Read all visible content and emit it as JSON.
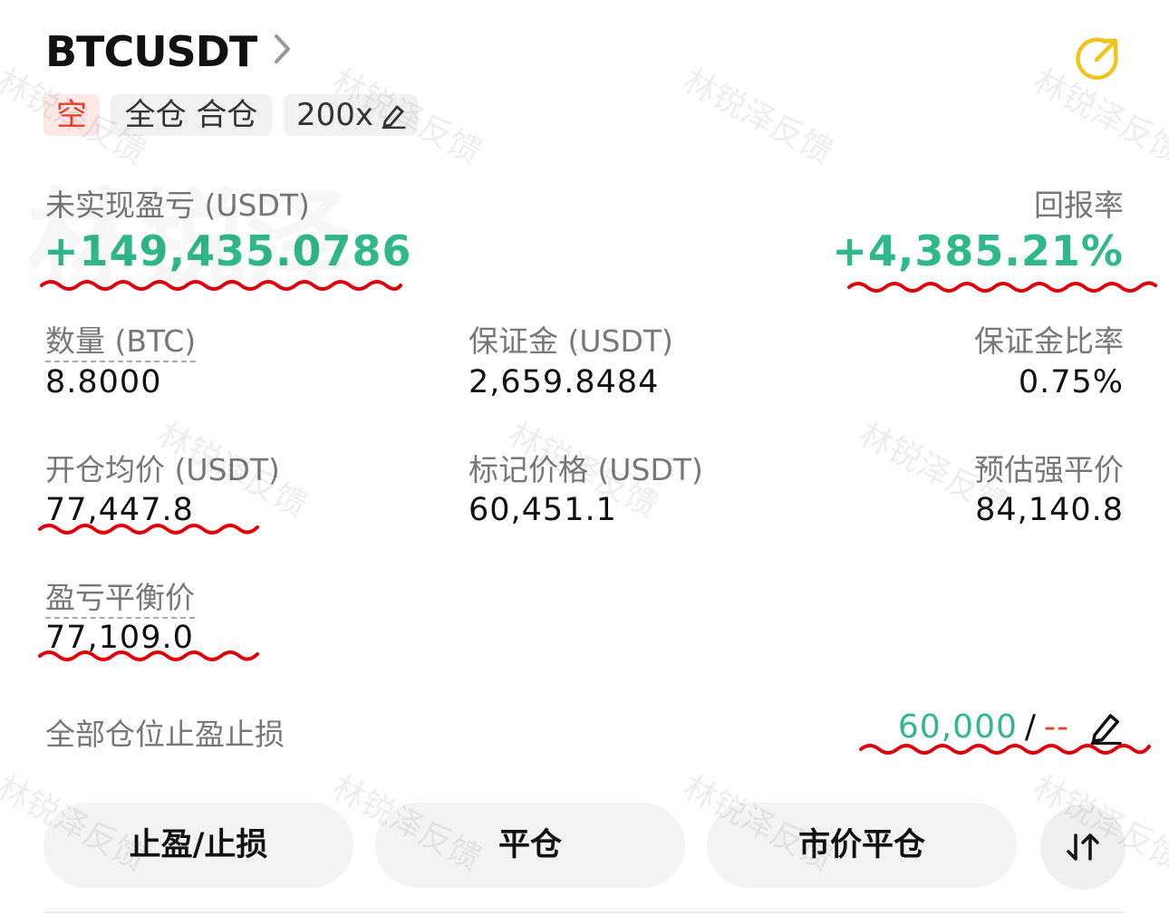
{
  "header": {
    "symbol": "BTCUSDT",
    "tags": {
      "side": "空",
      "margin_mode": "全仓 合仓",
      "leverage": "200x"
    }
  },
  "pnl": {
    "unrealized_label": "未实现盈亏 (USDT)",
    "unrealized_value": "+149,435.0786",
    "roi_label": "回报率",
    "roi_value": "+4,385.21%"
  },
  "stats": {
    "quantity_label": "数量 (BTC)",
    "quantity_value": "8.8000",
    "margin_label": "保证金 (USDT)",
    "margin_value": "2,659.8484",
    "margin_ratio_label": "保证金比率",
    "margin_ratio_value": "0.75%",
    "entry_label": "开仓均价 (USDT)",
    "entry_value": "77,447.8",
    "mark_label": "标记价格 (USDT)",
    "mark_value": "60,451.1",
    "liq_label": "预估强平价",
    "liq_value": "84,140.8",
    "breakeven_label": "盈亏平衡价",
    "breakeven_value": "77,109.0"
  },
  "tpsl": {
    "label": "全部仓位止盈止损",
    "tp_value": "60,000",
    "separator": "/",
    "sl_value": "--"
  },
  "actions": {
    "tpsl_button": "止盈/止损",
    "close_button": "平仓",
    "market_close_button": "市价平仓"
  },
  "watermark": {
    "text": "林锐泽反馈",
    "big_text": "林锐泽"
  },
  "colors": {
    "profit": "#2fb88a",
    "loss": "#e8412d",
    "accent": "#f0c419",
    "annotation": "#e0000a"
  },
  "icons": [
    "chevron-right-icon",
    "share-icon",
    "edit-icon",
    "swap-icon"
  ]
}
